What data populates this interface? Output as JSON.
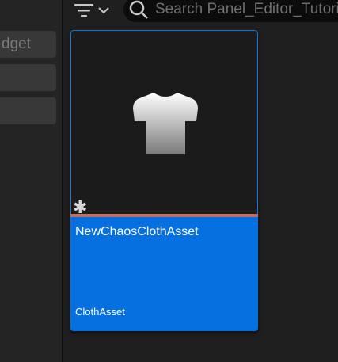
{
  "sidebar": {
    "items": [
      {
        "label": "dget"
      },
      {
        "label": ""
      },
      {
        "label": ""
      }
    ]
  },
  "toolbar": {
    "filter_icon": "filter-icon",
    "dropdown_icon": "chevron-down-icon",
    "search": {
      "placeholder": "Search Panel_Editor_Tutorial",
      "value": "",
      "icon": "search-icon"
    }
  },
  "asset": {
    "name": "NewChaosClothAsset",
    "type": "ClothAsset",
    "thumbnail_icon": "tshirt-icon",
    "badge_icon": "asterisk-icon",
    "badge_text": "✱",
    "type_color": "#c36c62",
    "selected_color": "#0670e0"
  }
}
